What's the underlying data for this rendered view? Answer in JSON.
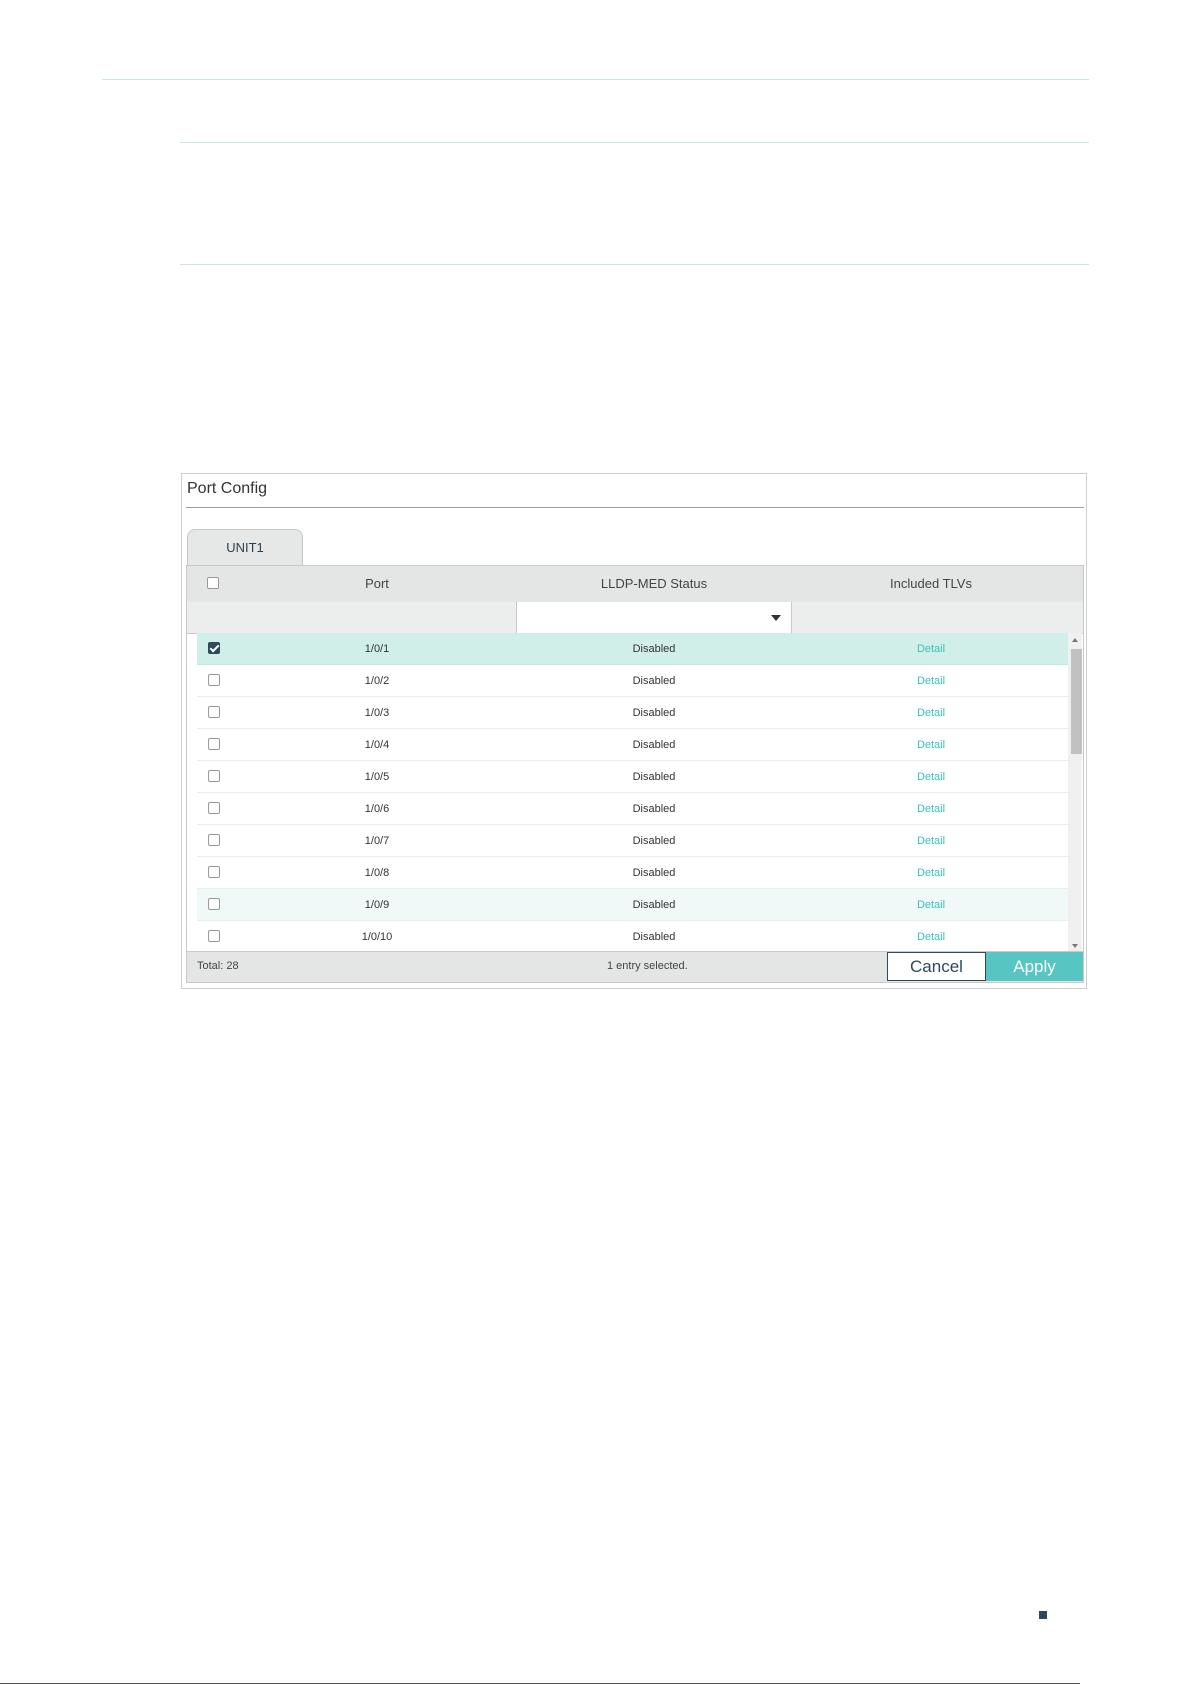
{
  "panel": {
    "title": "Port Config",
    "tab_label": "UNIT1",
    "columns": {
      "port": "Port",
      "status": "LLDP-MED Status",
      "tlvs": "Included TLVs"
    },
    "rows": [
      {
        "port": "1/0/1",
        "status": "Disabled",
        "tlvs": "Detail",
        "checked": true
      },
      {
        "port": "1/0/2",
        "status": "Disabled",
        "tlvs": "Detail",
        "checked": false
      },
      {
        "port": "1/0/3",
        "status": "Disabled",
        "tlvs": "Detail",
        "checked": false
      },
      {
        "port": "1/0/4",
        "status": "Disabled",
        "tlvs": "Detail",
        "checked": false
      },
      {
        "port": "1/0/5",
        "status": "Disabled",
        "tlvs": "Detail",
        "checked": false
      },
      {
        "port": "1/0/6",
        "status": "Disabled",
        "tlvs": "Detail",
        "checked": false
      },
      {
        "port": "1/0/7",
        "status": "Disabled",
        "tlvs": "Detail",
        "checked": false
      },
      {
        "port": "1/0/8",
        "status": "Disabled",
        "tlvs": "Detail",
        "checked": false
      },
      {
        "port": "1/0/9",
        "status": "Disabled",
        "tlvs": "Detail",
        "checked": false
      },
      {
        "port": "1/0/10",
        "status": "Disabled",
        "tlvs": "Detail",
        "checked": false
      }
    ],
    "footer": {
      "total": "Total: 28",
      "selected": "1 entry selected.",
      "cancel_label": "Cancel",
      "apply_label": "Apply"
    }
  },
  "colors": {
    "accent": "#57c5c1",
    "link": "#3cc0b8",
    "selected_row": "#d0efe9",
    "dark": "#2d4a5c"
  }
}
